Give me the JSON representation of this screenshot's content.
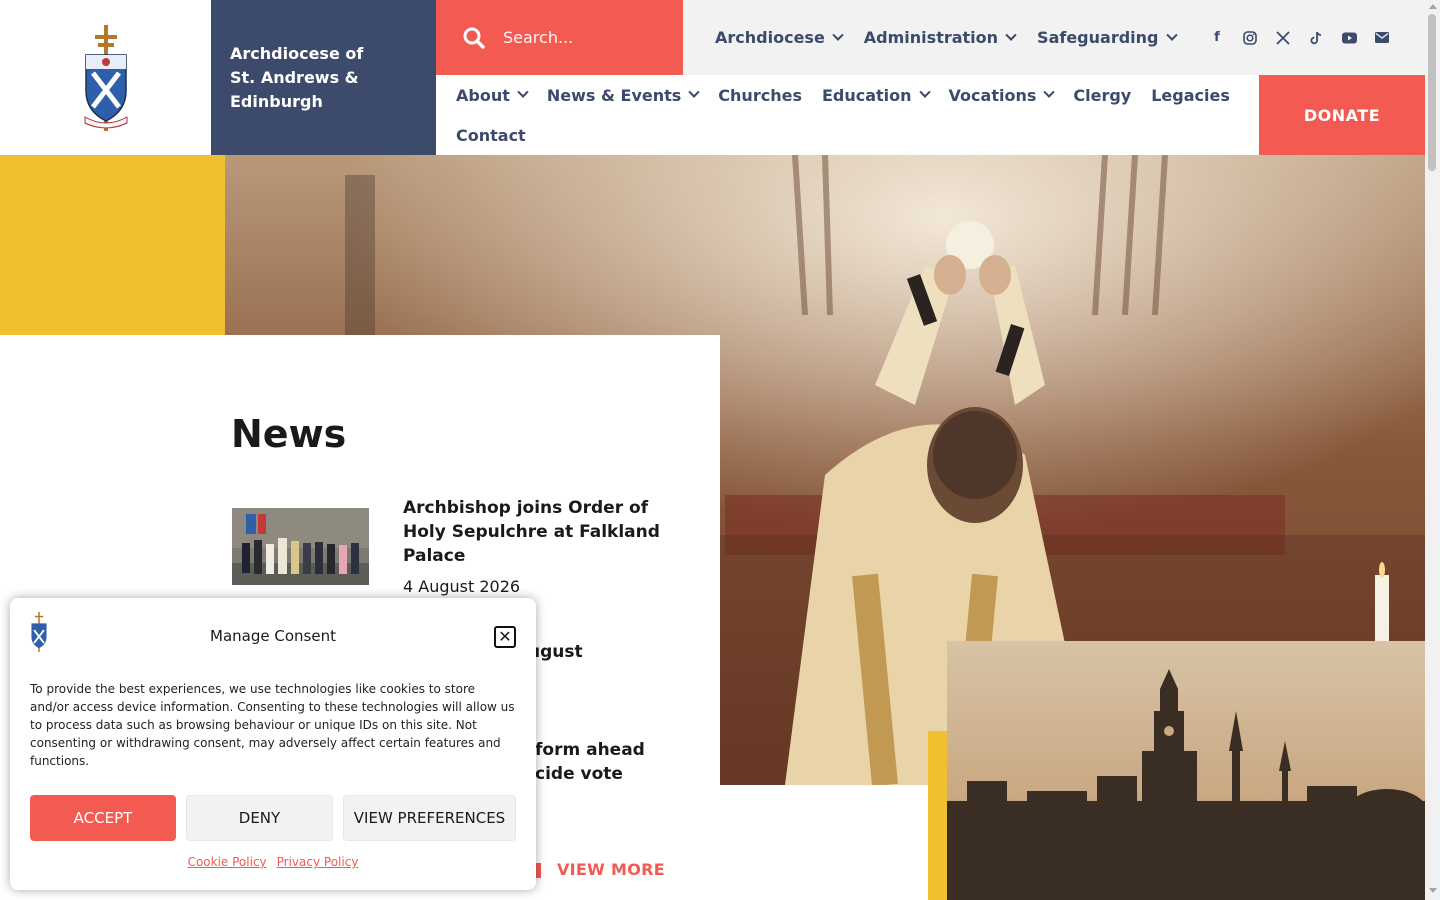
{
  "header": {
    "site_name_line1": "Archdiocese of",
    "site_name_line2": "St. Andrews &",
    "site_name_line3": "Edinburgh",
    "search_placeholder": "Search...",
    "top_nav": [
      "Archdiocese",
      "Administration",
      "Safeguarding"
    ],
    "social_icons": [
      "facebook-icon",
      "instagram-icon",
      "x-icon",
      "tiktok-icon",
      "youtube-icon",
      "email-icon"
    ],
    "main_nav": [
      {
        "label": "About",
        "dropdown": true
      },
      {
        "label": "News & Events",
        "dropdown": true
      },
      {
        "label": "Churches",
        "dropdown": false
      },
      {
        "label": "Education",
        "dropdown": true
      },
      {
        "label": "Vocations",
        "dropdown": true
      },
      {
        "label": "Clergy",
        "dropdown": false
      },
      {
        "label": "Legacies",
        "dropdown": false
      },
      {
        "label": "Contact",
        "dropdown": false
      }
    ],
    "donate_label": "DONATE"
  },
  "news": {
    "title": "News",
    "items": [
      {
        "headline": "Archbishop joins Order of Holy Sepulchre at Falkland Palace",
        "date": "4 August 2026"
      },
      {
        "headline": "ugust",
        "date": ""
      },
      {
        "headline": "form ahead cide vote",
        "date": ""
      }
    ],
    "view_more": "VIEW MORE"
  },
  "consent": {
    "title": "Manage Consent",
    "text": "To provide the best experiences, we use technologies like cookies to store and/or access device information. Consenting to these technologies will allow us to process data such as browsing behaviour or unique IDs on this site. Not consenting or withdrawing consent, may adversely affect certain features and functions.",
    "accept": "ACCEPT",
    "deny": "DENY",
    "preferences": "VIEW PREFERENCES",
    "cookie_policy": "Cookie Policy",
    "privacy_policy": "Privacy Policy"
  },
  "colors": {
    "navy": "#3c4a6b",
    "coral": "#f25a52",
    "yellow": "#f1bf2f",
    "light_gray": "#f2f2f2"
  }
}
